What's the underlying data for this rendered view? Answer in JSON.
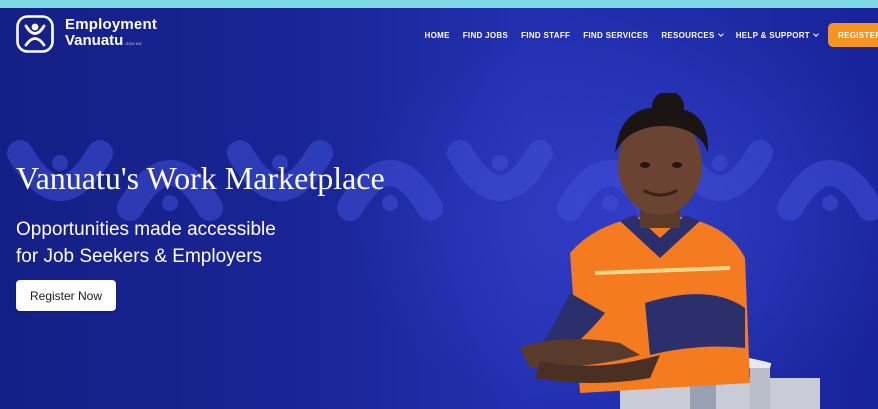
{
  "brand": {
    "name_line1": "Employment",
    "name_line2": "Vanuatu",
    "name_suffix": "GOV.VU",
    "logo_icon": "employment-vanuatu-logo"
  },
  "nav": {
    "items": [
      {
        "label": "HOME",
        "dropdown": false
      },
      {
        "label": "FIND JOBS",
        "dropdown": false
      },
      {
        "label": "FIND STAFF",
        "dropdown": false
      },
      {
        "label": "FIND SERVICES",
        "dropdown": false
      },
      {
        "label": "RESOURCES",
        "dropdown": true
      },
      {
        "label": "HELP & SUPPORT",
        "dropdown": true
      }
    ],
    "register_label": "REGISTER"
  },
  "hero": {
    "title": "Vanuatu's Work Marketplace",
    "subtitle_line1": "Opportunities made accessible",
    "subtitle_line2": "for Job Seekers & Employers",
    "cta_label": "Register Now"
  },
  "colors": {
    "hero_background": "#1a2596",
    "accent": "#f7931e",
    "top_strip": "#7fd9e4"
  }
}
